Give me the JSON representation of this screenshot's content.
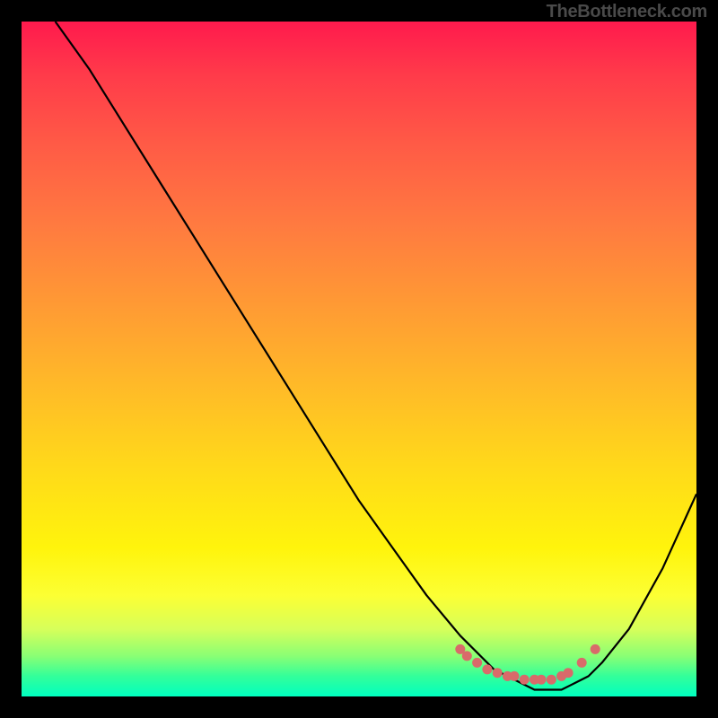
{
  "watermark": "TheBottleneck.com",
  "chart_data": {
    "type": "line",
    "title": "",
    "xlabel": "",
    "ylabel": "",
    "xlim": [
      0,
      100
    ],
    "ylim": [
      0,
      100
    ],
    "grid": false,
    "legend": false,
    "annotations": [],
    "gradient_meaning": "background gradient red (top, high bottleneck) to green (bottom, no bottleneck)",
    "series": [
      {
        "name": "bottleneck-curve",
        "color": "#000000",
        "x": [
          5,
          10,
          15,
          20,
          25,
          30,
          35,
          40,
          45,
          50,
          55,
          60,
          65,
          70,
          72,
          74,
          76,
          78,
          80,
          82,
          84,
          86,
          90,
          95,
          100
        ],
        "y": [
          100,
          93,
          85,
          77,
          69,
          61,
          53,
          45,
          37,
          29,
          22,
          15,
          9,
          4,
          3,
          2,
          1,
          1,
          1,
          2,
          3,
          5,
          10,
          19,
          30
        ]
      },
      {
        "name": "marker-dots",
        "type": "scatter",
        "color": "#d96a6a",
        "x": [
          65,
          66,
          67.5,
          69,
          70.5,
          72,
          73,
          74.5,
          76,
          77,
          78.5,
          80,
          81,
          83,
          85
        ],
        "y": [
          7,
          6,
          5,
          4,
          3.5,
          3,
          3,
          2.5,
          2.5,
          2.5,
          2.5,
          3,
          3.5,
          5,
          7
        ]
      }
    ]
  }
}
